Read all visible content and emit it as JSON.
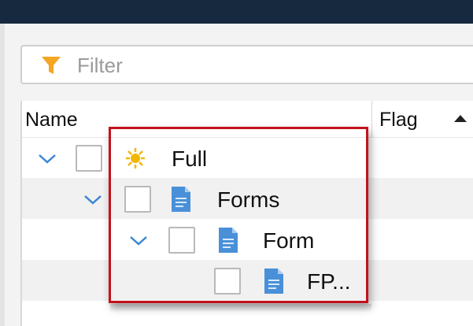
{
  "filter": {
    "icon": "filter-icon",
    "placeholder": "Filter"
  },
  "columns": {
    "name": "Name",
    "flag": "Flag"
  },
  "tree": {
    "nodes": [
      {
        "label": "Full",
        "icon": "sun-icon",
        "expanded": true,
        "checked": false
      },
      {
        "label": "Forms",
        "icon": "document-icon",
        "expanded": true,
        "checked": false
      },
      {
        "label": "Form",
        "icon": "document-icon",
        "expanded": true,
        "checked": false
      },
      {
        "label": "FP...",
        "icon": "document-icon",
        "expanded": false,
        "checked": false
      }
    ]
  },
  "colors": {
    "titlebar": "#17293f",
    "highlight": "#c4121b",
    "filter_icon": "#f5a623",
    "sun_icon": "#f2b705",
    "document_icon": "#4a90d9",
    "chevron": "#3a86d4"
  }
}
